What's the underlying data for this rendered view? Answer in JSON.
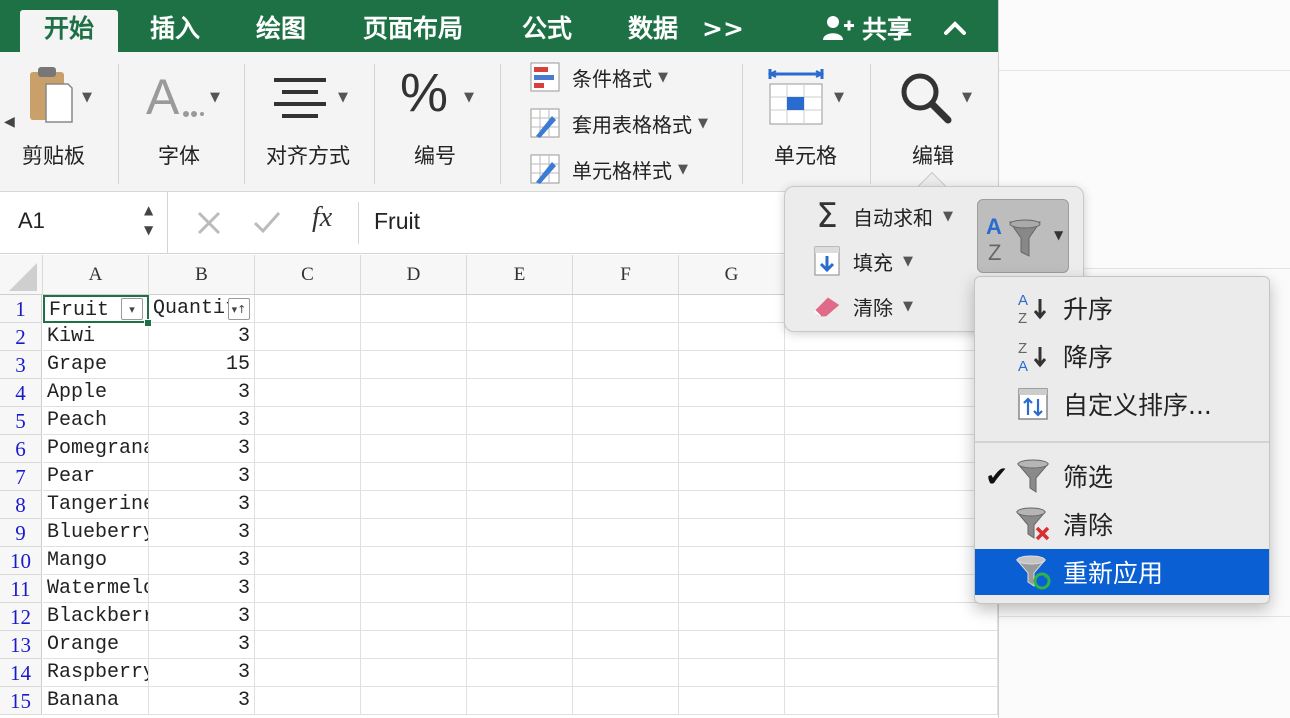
{
  "ribbon_tabs": [
    {
      "label": "开始",
      "active": true
    },
    {
      "label": "插入"
    },
    {
      "label": "绘图"
    },
    {
      "label": "页面布局"
    },
    {
      "label": "公式"
    },
    {
      "label": "数据"
    },
    {
      "label": ">>"
    }
  ],
  "share_label": "共享",
  "ribbon_groups": {
    "clipboard": "剪贴板",
    "font": "字体",
    "alignment": "对齐方式",
    "number": "编号",
    "cells": "单元格",
    "editing": "编辑"
  },
  "styles_buttons": [
    "条件格式",
    "套用表格格式",
    "单元格样式"
  ],
  "formula_bar": {
    "name_box": "A1",
    "fx": "fx",
    "content": "Fruit"
  },
  "columns": [
    "A",
    "B",
    "C",
    "D",
    "E",
    "F",
    "G"
  ],
  "rows": [
    {
      "n": "1",
      "a": "Fruit",
      "b": "Quantity"
    },
    {
      "n": "2",
      "a": "Kiwi",
      "b": "3"
    },
    {
      "n": "3",
      "a": "Grape",
      "b": "15"
    },
    {
      "n": "4",
      "a": "Apple",
      "b": "3"
    },
    {
      "n": "5",
      "a": "Peach",
      "b": "3"
    },
    {
      "n": "6",
      "a": "Pomegranate",
      "b": "3"
    },
    {
      "n": "7",
      "a": "Pear",
      "b": "3"
    },
    {
      "n": "8",
      "a": "Tangerine",
      "b": "3"
    },
    {
      "n": "9",
      "a": "Blueberry",
      "b": "3"
    },
    {
      "n": "10",
      "a": "Mango",
      "b": "3"
    },
    {
      "n": "11",
      "a": "Watermelon",
      "b": "3"
    },
    {
      "n": "12",
      "a": "Blackberry",
      "b": "3"
    },
    {
      "n": "13",
      "a": "Orange",
      "b": "3"
    },
    {
      "n": "14",
      "a": "Raspberry",
      "b": "3"
    },
    {
      "n": "15",
      "a": "Banana",
      "b": "3"
    }
  ],
  "editing_popover": {
    "autosum": "自动求和",
    "fill": "填充",
    "clear": "清除"
  },
  "sort_filter_menu": {
    "ascending": "升序",
    "descending": "降序",
    "custom_sort": "自定义排序...",
    "filter": "筛选",
    "clear": "清除",
    "reapply": "重新应用",
    "filter_checked": true,
    "highlighted_item": "重新应用"
  },
  "colors": {
    "ribbon_green": "#1e7145",
    "selection_blue": "#0a5fd3",
    "row_number_blue": "#1a1acc"
  }
}
